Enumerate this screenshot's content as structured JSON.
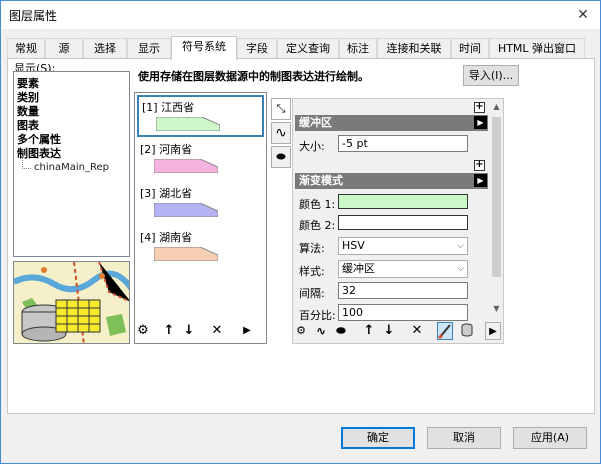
{
  "window": {
    "title": "图层属性",
    "close_glyph": "✕"
  },
  "tabs": [
    "常规",
    "源",
    "选择",
    "显示",
    "符号系统",
    "字段",
    "定义查询",
    "标注",
    "连接和关联",
    "时间",
    "HTML 弹出窗口"
  ],
  "left": {
    "show_label": "显示(S):",
    "categories": [
      "要素",
      "类别",
      "数量",
      "图表",
      "多个属性",
      "制图表达"
    ],
    "sub_item": "chinaMain_Rep"
  },
  "main": {
    "description": "使用存储在图层数据源中的制图表达进行绘制。",
    "import_label": "导入(I)..."
  },
  "representations": [
    {
      "label": "[1] 江西省",
      "color": "#ccf7c8"
    },
    {
      "label": "[2] 河南省",
      "color": "#f7b3e0"
    },
    {
      "label": "[3] 湖北省",
      "color": "#b6b3f4"
    },
    {
      "label": "[4] 湖南省",
      "color": "#f7d0b3"
    }
  ],
  "properties": {
    "buffer_title": "缓冲区",
    "size_label": "大小:",
    "size_value": "-5 pt",
    "gradient_title": "渐变模式",
    "color1_label": "颜色 1:",
    "color1_value": "#ccf7c8",
    "color2_label": "颜色 2:",
    "color2_value": "#ffffff",
    "algorithm_label": "算法:",
    "algorithm_value": "HSV",
    "style_label": "样式:",
    "style_value": "缓冲区",
    "interval_label": "间隔:",
    "interval_value": "32",
    "percent_label": "百分比:",
    "percent_value": "100"
  },
  "buttons": {
    "ok": "确定",
    "cancel": "取消",
    "apply": "应用(A)"
  },
  "colors": {
    "accent": "#0078d7",
    "selection": "#3c7fb1",
    "section_header": "#7a7a7a"
  },
  "icons": {
    "gear": "⚙",
    "up": "↑",
    "down": "↓",
    "delete": "✕",
    "play": "▶",
    "pointer": "⤡",
    "wave": "∿",
    "blob": "⬬",
    "plus": "+",
    "dropdown": "⌵"
  }
}
